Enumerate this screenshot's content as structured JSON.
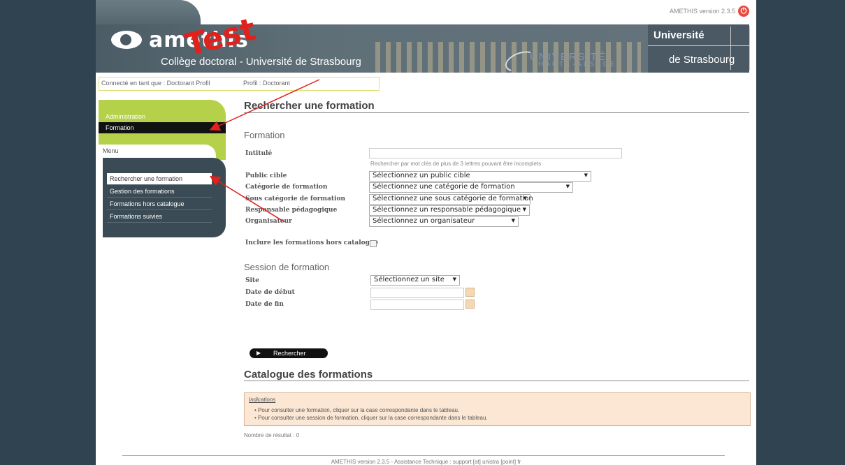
{
  "app": {
    "version_label": "AMETHIS version 2.3.5",
    "logo_text": "amethis",
    "college_text": "Collège doctoral - Université de Strasbourg",
    "watermark": "Test",
    "uha_line1": "UNIVERSITÉ",
    "uha_line2": "HAUTE-ALSACE",
    "unistra_line1": "Université",
    "unistra_line2": "de Strasbourg"
  },
  "status": {
    "connected": "Connecté en tant que : Doctorant Profil",
    "profile": "Profil : Doctorant"
  },
  "sidebar": {
    "admin_label": "Administration",
    "formation_label": "Formation",
    "menu_label": "Menu",
    "items": [
      {
        "label": "Rechercher une formation"
      },
      {
        "label": "Gestion des formations"
      },
      {
        "label": "Formations hors catalogue"
      },
      {
        "label": "Formations suivies"
      }
    ]
  },
  "main": {
    "title": "Rechercher une formation",
    "formation_section": "Formation",
    "labels": {
      "intitule": "Intitulé",
      "public": "Public cible",
      "categorie": "Catégorie de formation",
      "sous_categorie": "Sous catégorie de formation",
      "responsable": "Responsable pédagogique",
      "organisateur": "Organisateur",
      "hors_catalogue": "Inclure les formations hors catalogue"
    },
    "hint": "Rechercher par mot clés de plus de 3 lettres pouvant être incomplets",
    "selects": {
      "public": "Sélectionnez un public cible",
      "categorie": "Sélectionnez une catégorie de formation",
      "sous_categorie": "Sélectionnez une sous catégorie de formation",
      "responsable": "Sélectionnez un responsable pédagogique",
      "organisateur": "Sélectionnez un organisateur"
    },
    "session_section": "Session de formation",
    "session_labels": {
      "site": "Site",
      "date_debut": "Date de début",
      "date_fin": "Date de fin"
    },
    "site_select": "Sélectionnez un site",
    "search_button": "Rechercher",
    "catalogue_title": "Catalogue des formations",
    "indications": {
      "title": "Indications",
      "line1": "Pour consulter une formation, cliquer sur la case correspondante dans le tableau.",
      "line2": "Pour consulter une session de formation, cliquer sur la case correspondante dans le tableau."
    },
    "result_count": "Nombre de résultat : 0"
  },
  "footer": {
    "text": "AMETHIS version 2.3.5 - Assistance Technique : support [at] unistra [point] fr"
  },
  "colors": {
    "background": "#2f4450",
    "accent_green": "#b5d14a",
    "arrow_red": "#e0211c"
  }
}
